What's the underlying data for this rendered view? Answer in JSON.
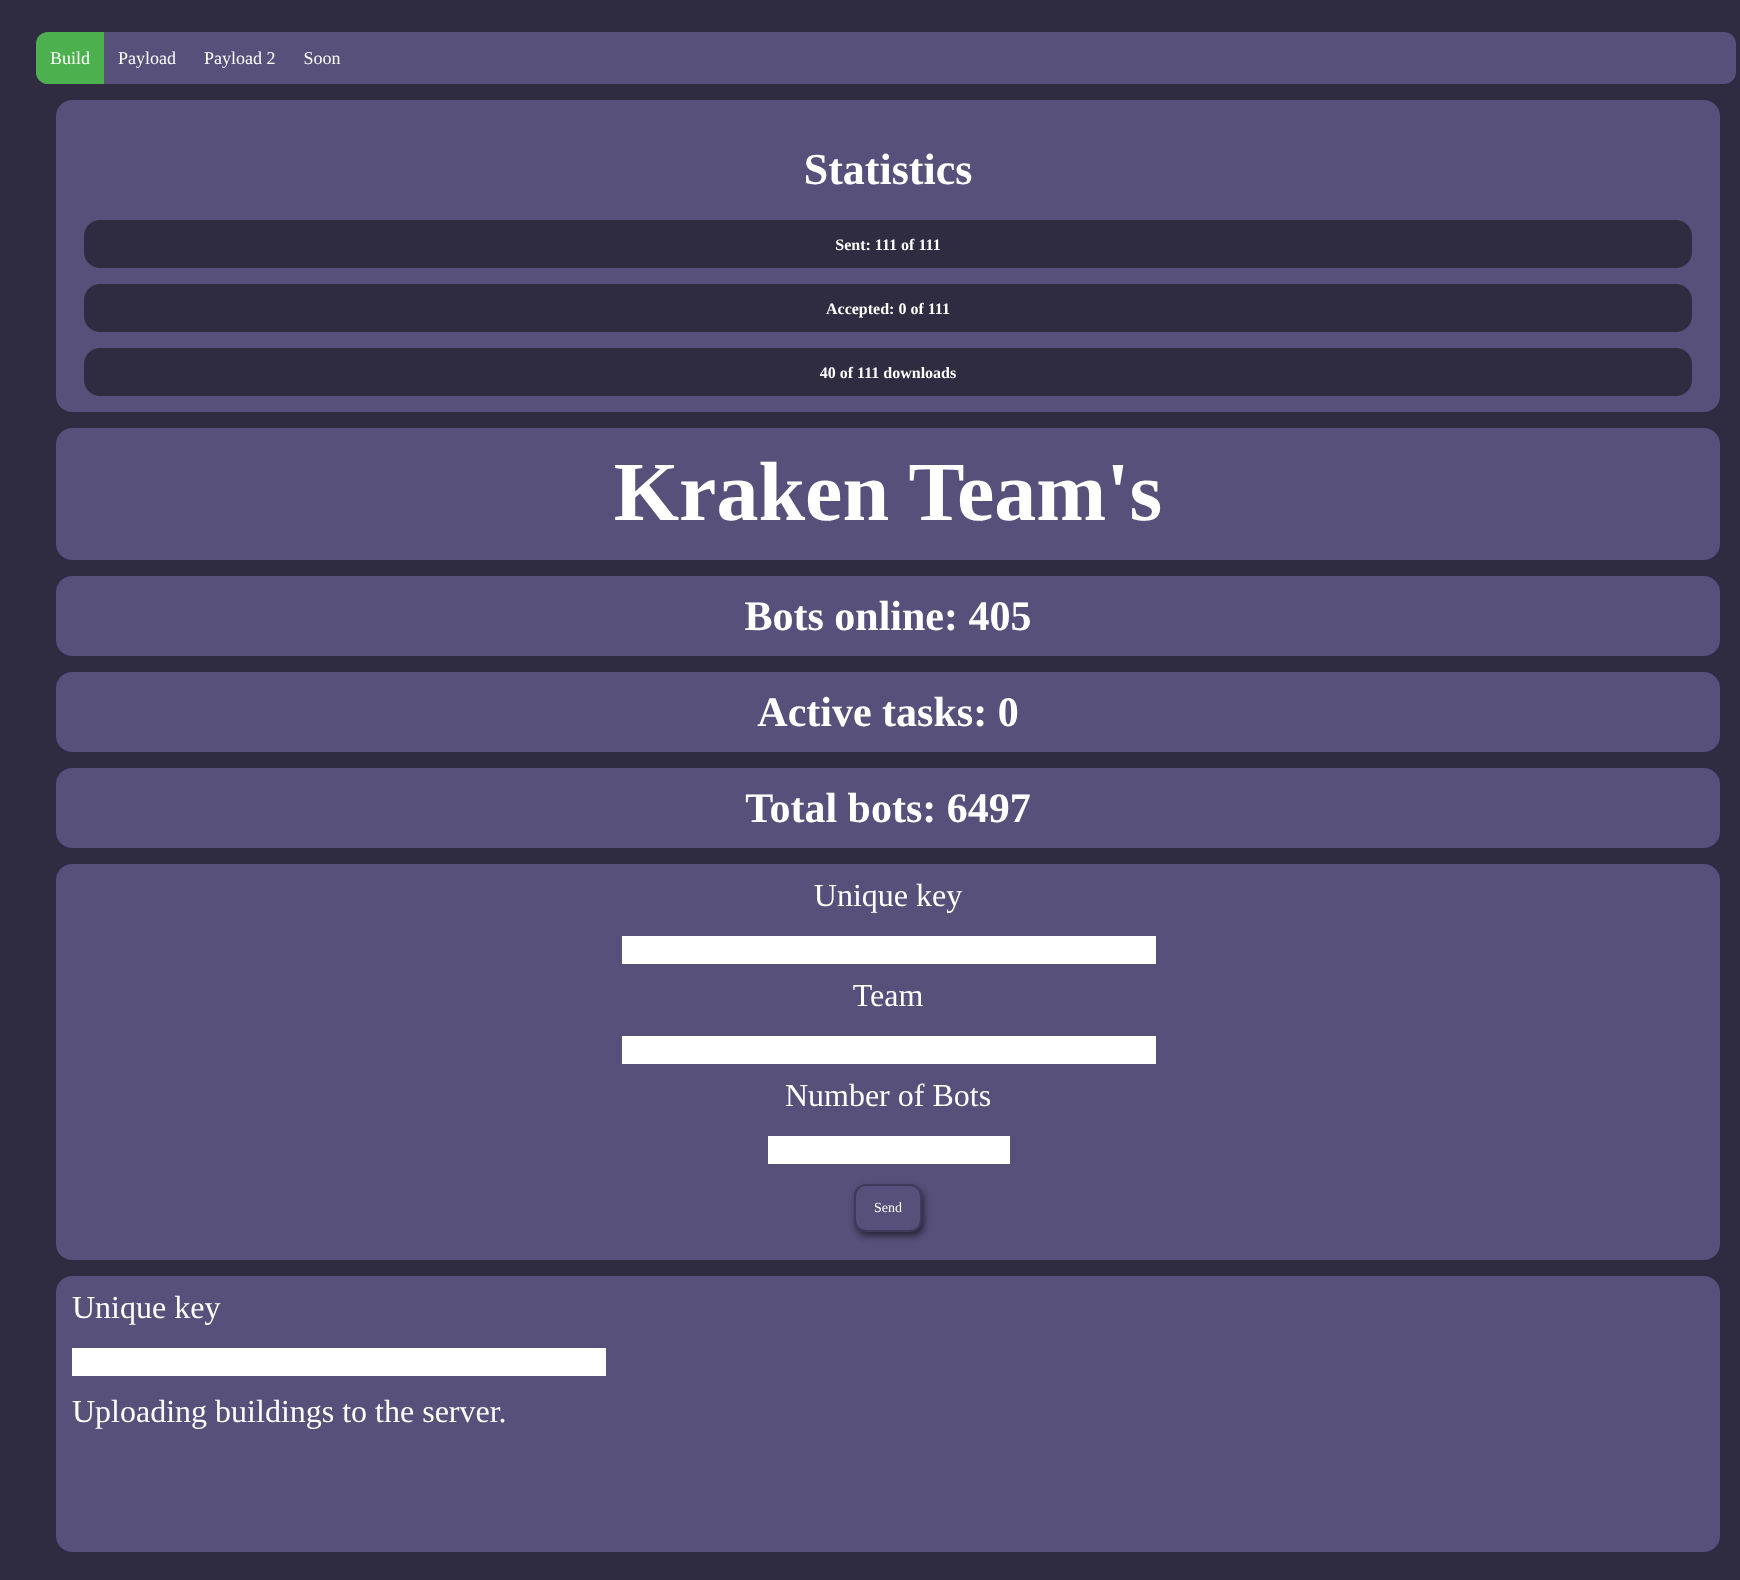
{
  "nav": {
    "tabs": [
      {
        "label": "Build",
        "selected": true
      },
      {
        "label": "Payload",
        "selected": false
      },
      {
        "label": "Payload 2",
        "selected": false
      },
      {
        "label": "Soon",
        "selected": false
      }
    ]
  },
  "statistics": {
    "title": "Statistics",
    "rows": [
      "Sent: 111 of 111",
      "Accepted: 0 of 111",
      "40 of 111 downloads"
    ]
  },
  "headline": "Kraken Team's",
  "counters": [
    "Bots online: 405",
    "Active tasks: 0",
    "Total bots: 6497"
  ],
  "task_form": {
    "fields": [
      {
        "label": "Unique key",
        "kind": "wide"
      },
      {
        "label": "Team",
        "kind": "wide"
      },
      {
        "label": "Number of Bots",
        "kind": "narrow"
      }
    ],
    "button": "Send"
  },
  "upload_form": {
    "field_label": "Unique key",
    "note": "Uploading buildings to the server."
  }
}
